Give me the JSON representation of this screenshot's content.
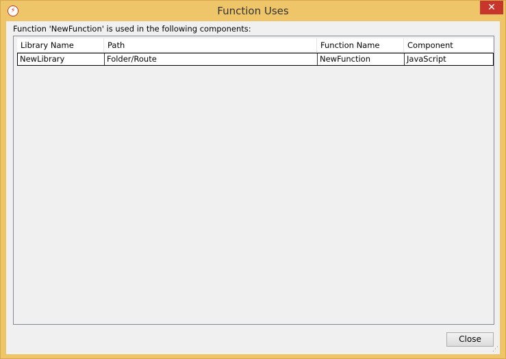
{
  "window": {
    "title": "Function Uses",
    "close_glyph": "✕",
    "app_icon_glyph": "⚡"
  },
  "description": "Function 'NewFunction' is used in the following components:",
  "table": {
    "columns": [
      "Library Name",
      "Path",
      "Function Name",
      "Component"
    ],
    "rows": [
      [
        "NewLibrary",
        "Folder/Route",
        "NewFunction",
        "JavaScript"
      ]
    ]
  },
  "buttons": {
    "close": "Close"
  },
  "colors": {
    "frame": "#efc56a",
    "close_button": "#c7362d",
    "client_bg": "#f0f0f0"
  }
}
